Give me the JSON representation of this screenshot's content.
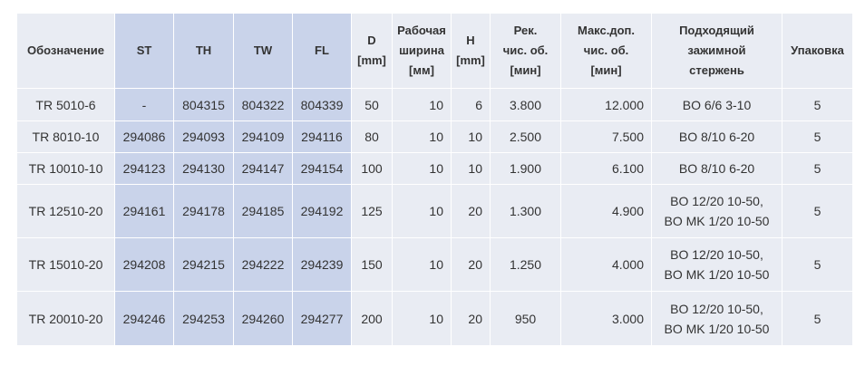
{
  "table": {
    "headers": {
      "designation": "Обозначение",
      "st": "ST",
      "th": "TH",
      "tw": "TW",
      "fl": "FL",
      "d": "D [mm]",
      "width": "Рабочая ширина [мм]",
      "h": "H [mm]",
      "rec_speed": "Рек. чис. об. [мин]",
      "max_speed": "Макс.доп. чис. об. [мин]",
      "shank": "Подходящий зажимной стержень",
      "pack": "Упаковка"
    },
    "rows": [
      {
        "designation": "TR 5010-6",
        "st": "-",
        "th": "804315",
        "tw": "804322",
        "fl": "804339",
        "d": "50",
        "width": "10",
        "h": "6",
        "rec_speed": "3.800",
        "max_speed": "12.000",
        "shank": [
          "BO 6/6 3-10"
        ],
        "pack": "5"
      },
      {
        "designation": "TR 8010-10",
        "st": "294086",
        "th": "294093",
        "tw": "294109",
        "fl": "294116",
        "d": "80",
        "width": "10",
        "h": "10",
        "rec_speed": "2.500",
        "max_speed": "7.500",
        "shank": [
          "BO 8/10 6-20"
        ],
        "pack": "5"
      },
      {
        "designation": "TR 10010-10",
        "st": "294123",
        "th": "294130",
        "tw": "294147",
        "fl": "294154",
        "d": "100",
        "width": "10",
        "h": "10",
        "rec_speed": "1.900",
        "max_speed": "6.100",
        "shank": [
          "BO 8/10 6-20"
        ],
        "pack": "5"
      },
      {
        "designation": "TR 12510-20",
        "st": "294161",
        "th": "294178",
        "tw": "294185",
        "fl": "294192",
        "d": "125",
        "width": "10",
        "h": "20",
        "rec_speed": "1.300",
        "max_speed": "4.900",
        "shank": [
          "BO 12/20 10-50,",
          "BO MK 1/20 10-50"
        ],
        "pack": "5"
      },
      {
        "designation": "TR 15010-20",
        "st": "294208",
        "th": "294215",
        "tw": "294222",
        "fl": "294239",
        "d": "150",
        "width": "10",
        "h": "20",
        "rec_speed": "1.250",
        "max_speed": "4.000",
        "shank": [
          "BO 12/20 10-50,",
          "BO MK 1/20 10-50"
        ],
        "pack": "5"
      },
      {
        "designation": "TR 20010-20",
        "st": "294246",
        "th": "294253",
        "tw": "294260",
        "fl": "294277",
        "d": "200",
        "width": "10",
        "h": "20",
        "rec_speed": "950",
        "max_speed": "3.000",
        "shank": [
          "BO 12/20 10-50,",
          "BO MK 1/20 10-50"
        ],
        "pack": "5"
      }
    ]
  }
}
